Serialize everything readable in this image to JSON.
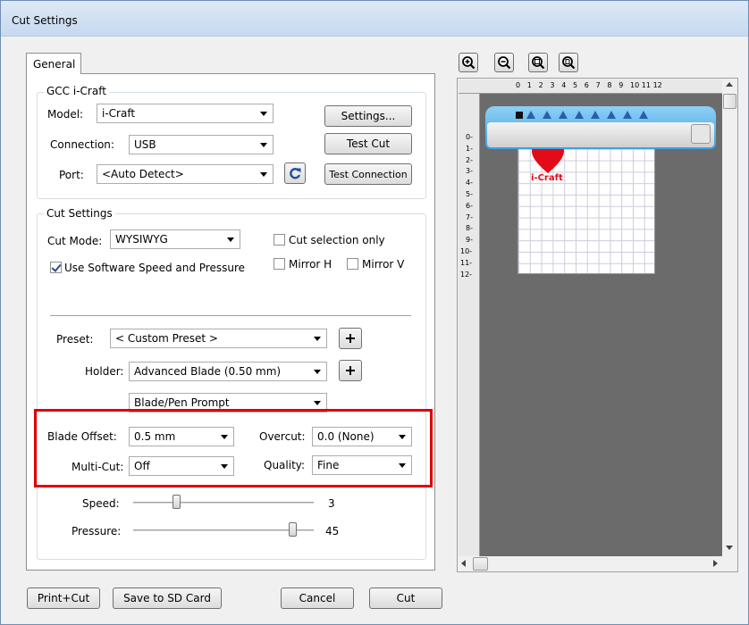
{
  "window": {
    "title": "Cut Settings"
  },
  "tabs": [
    {
      "label": "General"
    }
  ],
  "gcc": {
    "legend": "GCC i-Craft",
    "model_label": "Model:",
    "model_value": "i-Craft",
    "connection_label": "Connection:",
    "connection_value": "USB",
    "port_label": "Port:",
    "port_value": "<Auto Detect>",
    "settings_button": "Settings...",
    "test_cut_button": "Test Cut",
    "test_connection_button": "Test Connection"
  },
  "cut_settings": {
    "legend": "Cut Settings",
    "cut_mode_label": "Cut Mode:",
    "cut_mode_value": "WYSIWYG",
    "use_software_label": "Use Software Speed and Pressure",
    "use_software_checked": true,
    "cut_selection_label": "Cut selection only",
    "cut_selection_checked": false,
    "mirror_h_label": "Mirror H",
    "mirror_h_checked": false,
    "mirror_v_label": "Mirror V",
    "mirror_v_checked": false,
    "preset_label": "Preset:",
    "preset_value": "< Custom Preset >",
    "holder_label": "Holder:",
    "holder_value": "Advanced Blade (0.50 mm)",
    "prompt_value": "Blade/Pen Prompt",
    "blade_offset_label": "Blade Offset:",
    "blade_offset_value": "0.5 mm",
    "overcut_label": "Overcut:",
    "overcut_value": "0.0 (None)",
    "multicut_label": "Multi-Cut:",
    "multicut_value": "Off",
    "quality_label": "Quality:",
    "quality_value": "Fine",
    "speed_label": "Speed:",
    "speed_value": "3",
    "pressure_label": "Pressure:",
    "pressure_value": "45"
  },
  "preview": {
    "ruler_top": [
      "0",
      "1",
      "2",
      "3",
      "4",
      "5",
      "6",
      "7",
      "8",
      "9",
      "10",
      "11",
      "12"
    ],
    "ruler_left": [
      "0",
      "1",
      "2",
      "3",
      "4",
      "5",
      "6",
      "7",
      "8",
      "9",
      "10",
      "11",
      "12"
    ],
    "logo_text": "i-Craft",
    "zoom_buttons": [
      "zoom-in-icon",
      "zoom-out-icon",
      "zoom-fit-icon",
      "zoom-page-icon"
    ]
  },
  "footer": {
    "print_cut": "Print+Cut",
    "save_sd": "Save to SD Card",
    "cancel": "Cancel",
    "cut": "Cut"
  },
  "colors": {
    "highlight": "#e00000",
    "machine_blue": "#3aa0e3",
    "heart_red": "#e30b17"
  }
}
